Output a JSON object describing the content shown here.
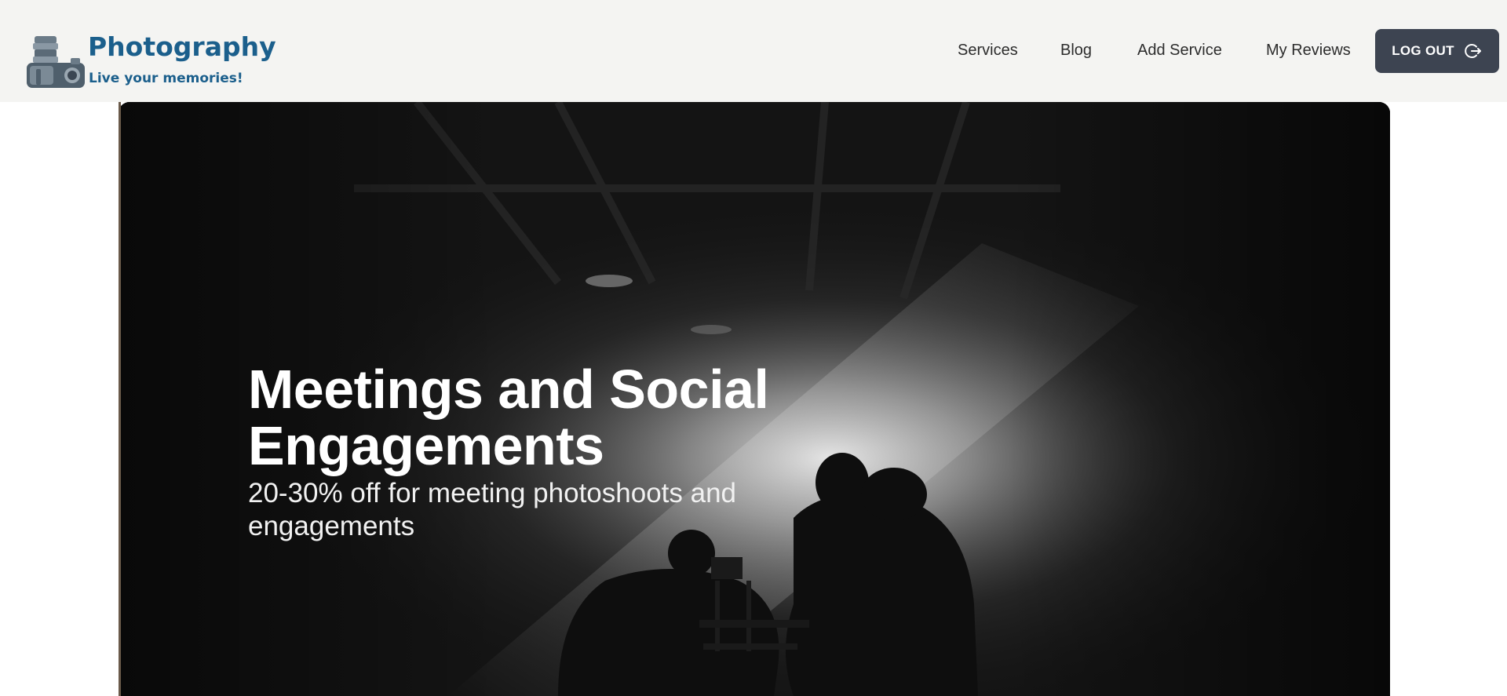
{
  "brand": {
    "title": "Photography",
    "tagline": "Live your memories!",
    "color": "#1b5f8c"
  },
  "nav": {
    "items": [
      {
        "label": "Services"
      },
      {
        "label": "Blog"
      },
      {
        "label": "Add Service"
      },
      {
        "label": "My Reviews"
      }
    ],
    "logout_label": "LOG OUT",
    "logout_icon": "logout-icon"
  },
  "hero": {
    "title": "Meetings and Social Engagements",
    "subtitle": "20-30% off for meeting photoshoots and engagements"
  },
  "colors": {
    "header_bg": "#f4f4f2",
    "button_bg": "#3d4451"
  }
}
